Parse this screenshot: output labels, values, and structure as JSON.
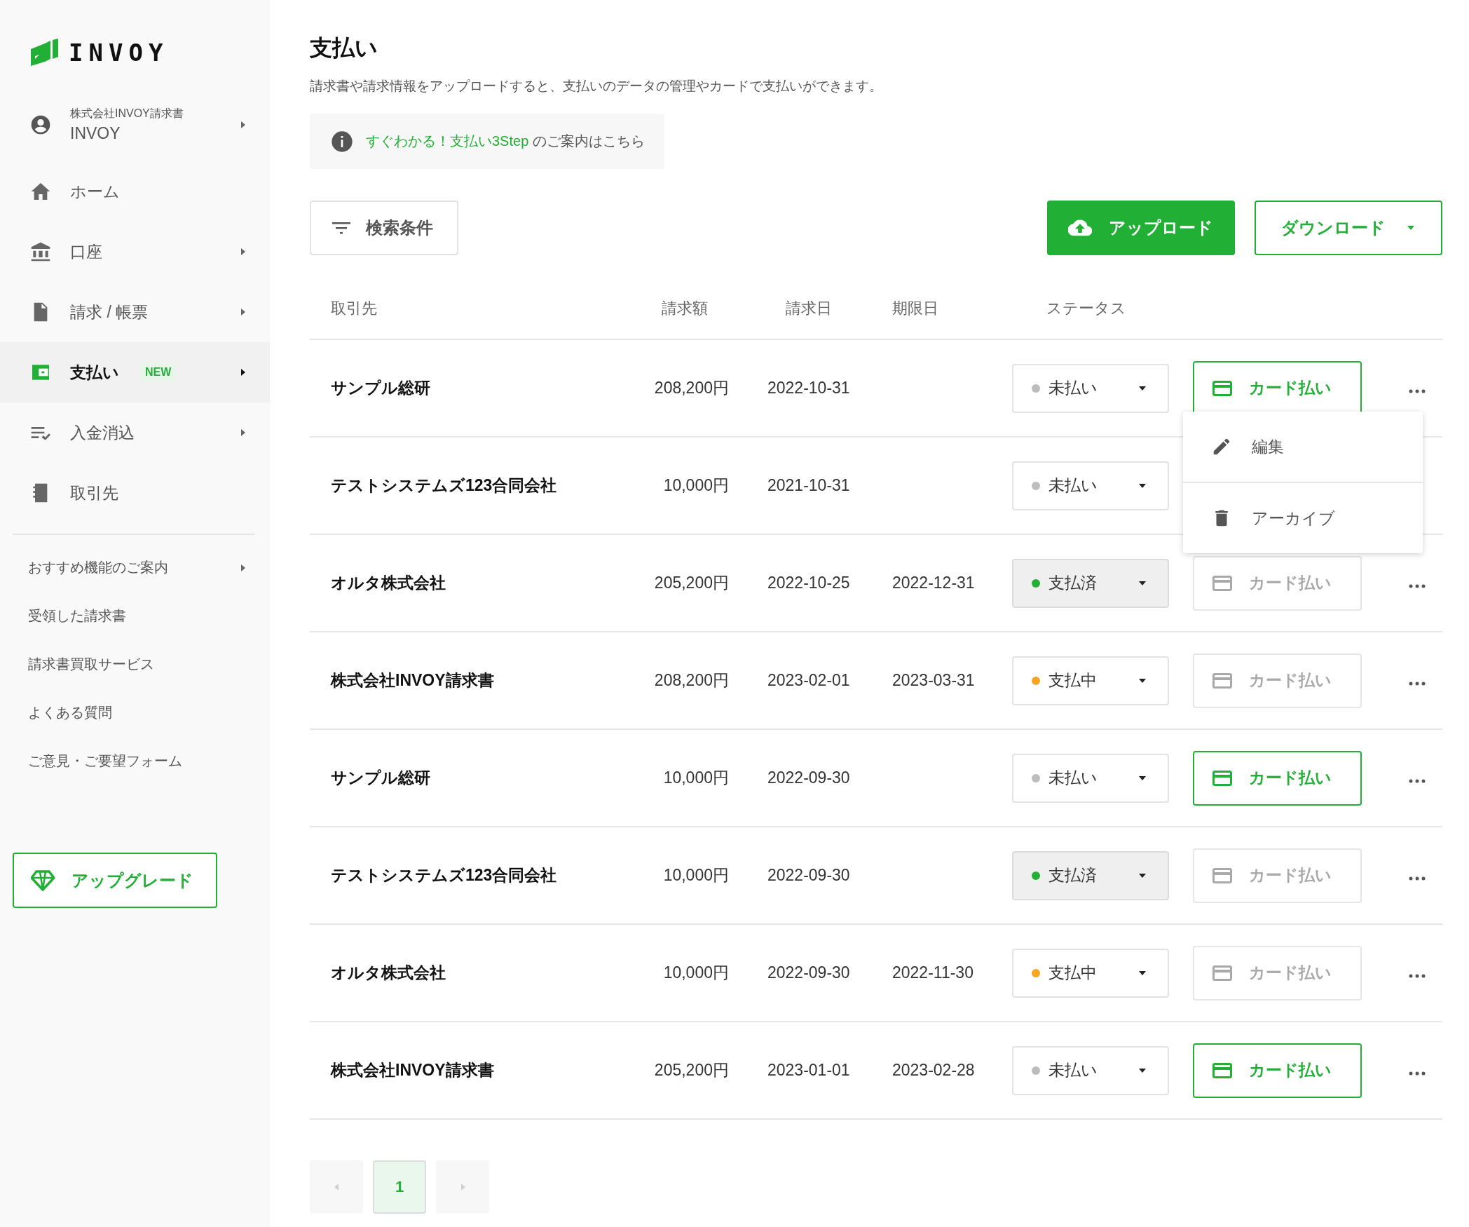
{
  "sidebar": {
    "logo": "INVOY",
    "account": {
      "company": "株式会社INVOY請求書",
      "name": "INVOY"
    },
    "items": [
      {
        "kind": "home",
        "label": "ホーム",
        "submenu": false,
        "selected": false
      },
      {
        "kind": "bank",
        "label": "口座",
        "submenu": true,
        "selected": false
      },
      {
        "kind": "document",
        "label": "請求 / 帳票",
        "submenu": true,
        "selected": false
      },
      {
        "kind": "wallet",
        "label": "支払い",
        "badge": "NEW",
        "submenu": true,
        "selected": true
      },
      {
        "kind": "checklist",
        "label": "入金消込",
        "submenu": true,
        "selected": false
      },
      {
        "kind": "book",
        "label": "取引先",
        "submenu": false,
        "selected": false
      }
    ],
    "links": [
      {
        "label": "おすすめ機能のご案内",
        "submenu": true
      },
      {
        "label": "受領した請求書",
        "submenu": false
      },
      {
        "label": "請求書買取サービス",
        "submenu": false
      },
      {
        "label": "よくある質問",
        "submenu": false
      },
      {
        "label": "ご意見・ご要望フォーム",
        "submenu": false
      }
    ],
    "upgrade_button": "アップグレード"
  },
  "page": {
    "title": "支払い",
    "description": "請求書や請求情報をアップロードすると、支払いのデータの管理やカードで支払いができます。",
    "info": {
      "link": "すぐわかる！支払い3Step",
      "text": " のご案内はこちら"
    }
  },
  "toolbar": {
    "filter_button": "検索条件",
    "upload_button": "アップロード",
    "download_button": "ダウンロード"
  },
  "table": {
    "columns": [
      "取引先",
      "請求額",
      "請求日",
      "期限日",
      "ステータス"
    ],
    "rows": [
      {
        "partner": "サンプル総研",
        "amount": "208,200円",
        "invoice_date": "2022-10-31",
        "status": {
          "label": "未払い",
          "color": "#bdbdbd",
          "disabled": false
        },
        "card_button": {
          "label": "カード払い",
          "disabled": false
        },
        "more": true
      },
      {
        "partner": "テストシステムズ123合同会社",
        "amount": "10,000円",
        "invoice_date": "2021-10-31",
        "status": {
          "label": "未払い",
          "color": "#bdbdbd",
          "disabled": false
        },
        "more": false
      },
      {
        "partner": "オルタ株式会社",
        "amount": "205,200円",
        "invoice_date": "2022-10-25",
        "due_date": "2022-12-31",
        "status": {
          "label": "支払済",
          "color": "#21b035",
          "disabled": true
        },
        "card_button": {
          "label": "カード払い",
          "disabled": true
        },
        "more": true
      },
      {
        "partner": "株式会社INVOY請求書",
        "amount": "208,200円",
        "invoice_date": "2023-02-01",
        "due_date": "2023-03-31",
        "status": {
          "label": "支払中",
          "color": "#f5a623",
          "disabled": false
        },
        "card_button": {
          "label": "カード払い",
          "disabled": true
        },
        "more": true
      },
      {
        "partner": "サンプル総研",
        "amount": "10,000円",
        "invoice_date": "2022-09-30",
        "status": {
          "label": "未払い",
          "color": "#bdbdbd",
          "disabled": false
        },
        "card_button": {
          "label": "カード払い",
          "disabled": false
        },
        "more": true
      },
      {
        "partner": "テストシステムズ123合同会社",
        "amount": "10,000円",
        "invoice_date": "2022-09-30",
        "status": {
          "label": "支払済",
          "color": "#21b035",
          "disabled": true
        },
        "card_button": {
          "label": "カード払い",
          "disabled": true
        },
        "more": true
      },
      {
        "partner": "オルタ株式会社",
        "amount": "10,000円",
        "invoice_date": "2022-09-30",
        "due_date": "2022-11-30",
        "status": {
          "label": "支払中",
          "color": "#f5a623",
          "disabled": false
        },
        "card_button": {
          "label": "カード払い",
          "disabled": true
        },
        "more": true
      },
      {
        "partner": "株式会社INVOY請求書",
        "amount": "205,200円",
        "invoice_date": "2023-01-01",
        "due_date": "2023-02-28",
        "status": {
          "label": "未払い",
          "color": "#bdbdbd",
          "disabled": false
        },
        "card_button": {
          "label": "カード払い",
          "disabled": false
        },
        "more": true
      }
    ],
    "menu": {
      "items": [
        {
          "kind": "edit",
          "label": "編集"
        },
        {
          "kind": "archive",
          "label": "アーカイブ"
        }
      ]
    }
  },
  "pagination": {
    "pages": [
      {
        "label": "1",
        "selected": true
      }
    ]
  }
}
